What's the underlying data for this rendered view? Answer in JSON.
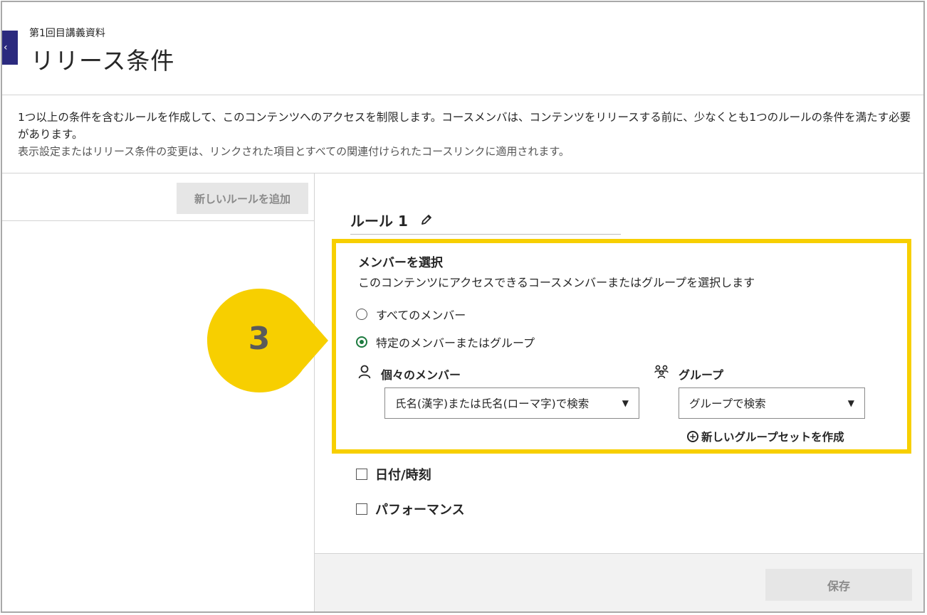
{
  "header": {
    "breadcrumb": "第1回目講義資料",
    "title": "リリース条件",
    "back_glyph": "‹"
  },
  "description": {
    "line1": "1つ以上の条件を含むルールを作成して、このコンテンツへのアクセスを制限します。コースメンバは、コンテンツをリリースする前に、少なくとも1つのルールの条件を満たす必要があります。",
    "line2": "表示設定またはリリース条件の変更は、リンクされた項目とすべての関連付けられたコースリンクに適用されます。"
  },
  "left_pane": {
    "add_rule_label": "新しいルールを追加"
  },
  "rule": {
    "title": "ルール 1",
    "edit_icon": "pencil-icon"
  },
  "member_select": {
    "title": "メンバーを選択",
    "description": "このコンテンツにアクセスできるコースメンバーまたはグループを選択します",
    "options": [
      {
        "label": "すべてのメンバー",
        "selected": false
      },
      {
        "label": "特定のメンバーまたはグループ",
        "selected": true
      }
    ],
    "individual": {
      "label": "個々のメンバー",
      "icon": "person-icon",
      "search_placeholder": "氏名(漢字)または氏名(ローマ字)で検索"
    },
    "group": {
      "label": "グループ",
      "icon": "group-icon",
      "search_placeholder": "グループで検索",
      "new_group_set_label": "新しいグループセットを作成"
    }
  },
  "criteria": [
    {
      "label": "日付/時刻",
      "checked": false
    },
    {
      "label": "パフォーマンス",
      "checked": false
    }
  ],
  "footer": {
    "save_label": "保存"
  },
  "callout": {
    "number": "3",
    "color": "#f7cf00"
  },
  "colors": {
    "accent_green": "#1c7a3e",
    "back_tab": "#2b2a7e",
    "highlight": "#f7cf00"
  }
}
